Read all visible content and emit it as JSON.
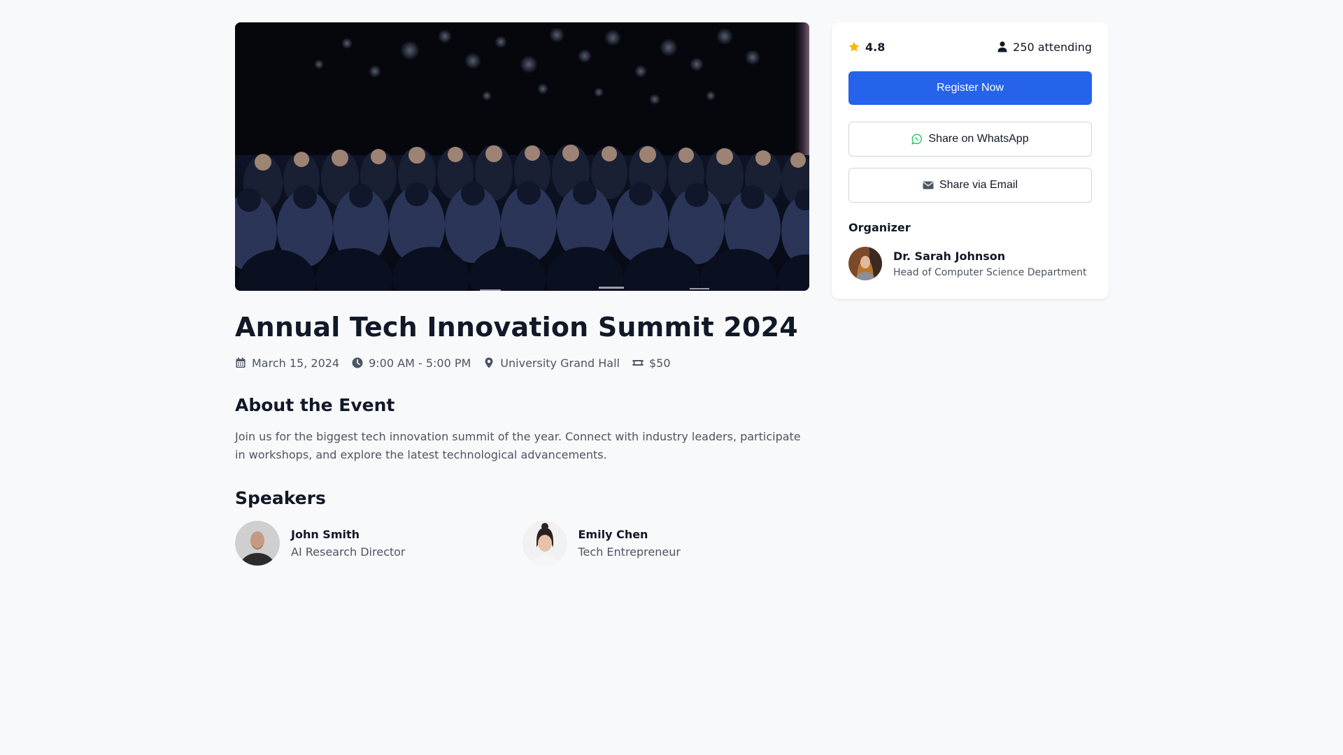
{
  "event": {
    "title": "Annual Tech Innovation Summit 2024",
    "date": "March 15, 2024",
    "time": "9:00 AM - 5:00 PM",
    "location": "University Grand Hall",
    "price": "$50",
    "hero_alt": "Audience seated at a conference"
  },
  "about": {
    "heading": "About the Event",
    "text": "Join us for the biggest tech innovation summit of the year. Connect with industry leaders, participate in workshops, and explore the latest technological advancements."
  },
  "speakers": {
    "heading": "Speakers",
    "items": [
      {
        "name": "John Smith",
        "role": "AI Research Director"
      },
      {
        "name": "Emily Chen",
        "role": "Tech Entrepreneur"
      }
    ]
  },
  "sidebar": {
    "rating": "4.8",
    "attending": "250 attending",
    "register_label": "Register Now",
    "whatsapp_label": "Share on WhatsApp",
    "email_label": "Share via Email",
    "organizer_heading": "Organizer",
    "organizer": {
      "name": "Dr. Sarah Johnson",
      "role": "Head of Computer Science Department"
    }
  },
  "colors": {
    "accent": "#2563eb",
    "star": "#f5b800",
    "whatsapp": "#22c55e",
    "background": "#f8f9fb"
  },
  "icons": {
    "date": "calendar-icon",
    "time": "clock-icon",
    "location": "map-pin-icon",
    "price": "ticket-icon",
    "rating": "star-icon",
    "attending": "user-icon",
    "whatsapp": "whatsapp-icon",
    "email": "envelope-icon"
  }
}
